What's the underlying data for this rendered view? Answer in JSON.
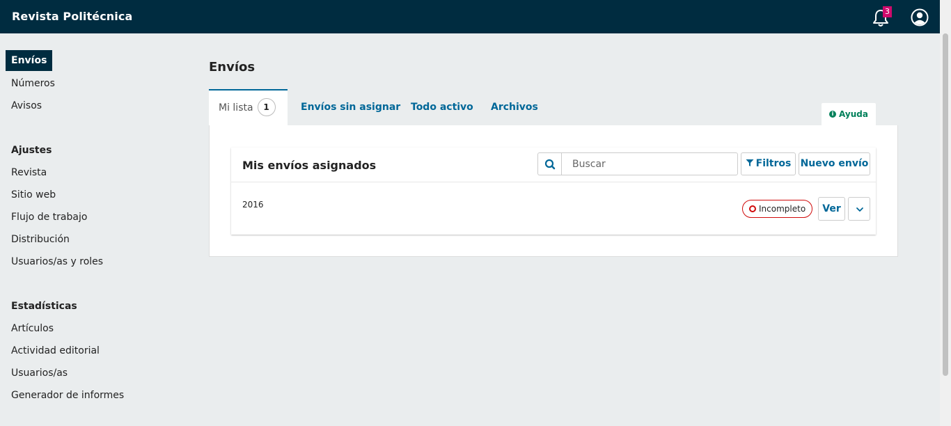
{
  "header": {
    "site_title": "Revista Politécnica",
    "notification_count": "3",
    "icons": [
      "bell-icon",
      "user-account-icon"
    ]
  },
  "sidebar": {
    "items": [
      {
        "label": "Envíos",
        "active": true
      },
      {
        "label": "Números"
      },
      {
        "label": "Avisos"
      }
    ],
    "settings_heading": "Ajustes",
    "settings_items": [
      "Revista",
      "Sitio web",
      "Flujo de trabajo",
      "Distribución",
      "Usuarios/as y roles"
    ],
    "stats_heading": "Estadísticas",
    "stats_items": [
      "Artículos",
      "Actividad editorial",
      "Usuarios/as",
      "Generador de informes"
    ]
  },
  "main": {
    "page_title": "Envíos",
    "tabs": [
      {
        "label": "Mi lista",
        "count": "1",
        "active": true
      },
      {
        "label": "Envíos sin asignar"
      },
      {
        "label": "Todo activo"
      },
      {
        "label": "Archivos"
      }
    ],
    "help_label": "Ayuda",
    "list_title": "Mis envíos asignados",
    "search_placeholder": "Buscar",
    "filters_label": "Filtros",
    "new_submission_label": "Nuevo envío",
    "submissions": [
      {
        "title": "2016",
        "status": "Incompleto",
        "view_label": "Ver"
      }
    ]
  },
  "colors": {
    "header_bg": "#002c40",
    "link": "#006798",
    "badge": "#d00a6c",
    "status_incomplete": "#d00a0a",
    "help": "#00805a"
  }
}
